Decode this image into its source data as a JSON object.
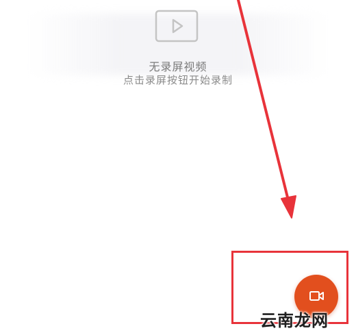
{
  "empty_state": {
    "icon": "video-play-icon",
    "title": "无录屏视频",
    "subtitle": "点击录屏按钮开始录制"
  },
  "annotation": {
    "arrow_color": "#e8333a",
    "box_color": "#e8333a"
  },
  "record_button": {
    "icon": "video-camera-icon",
    "color": "#e24f1e"
  },
  "watermark": {
    "text": "云南龙网"
  }
}
